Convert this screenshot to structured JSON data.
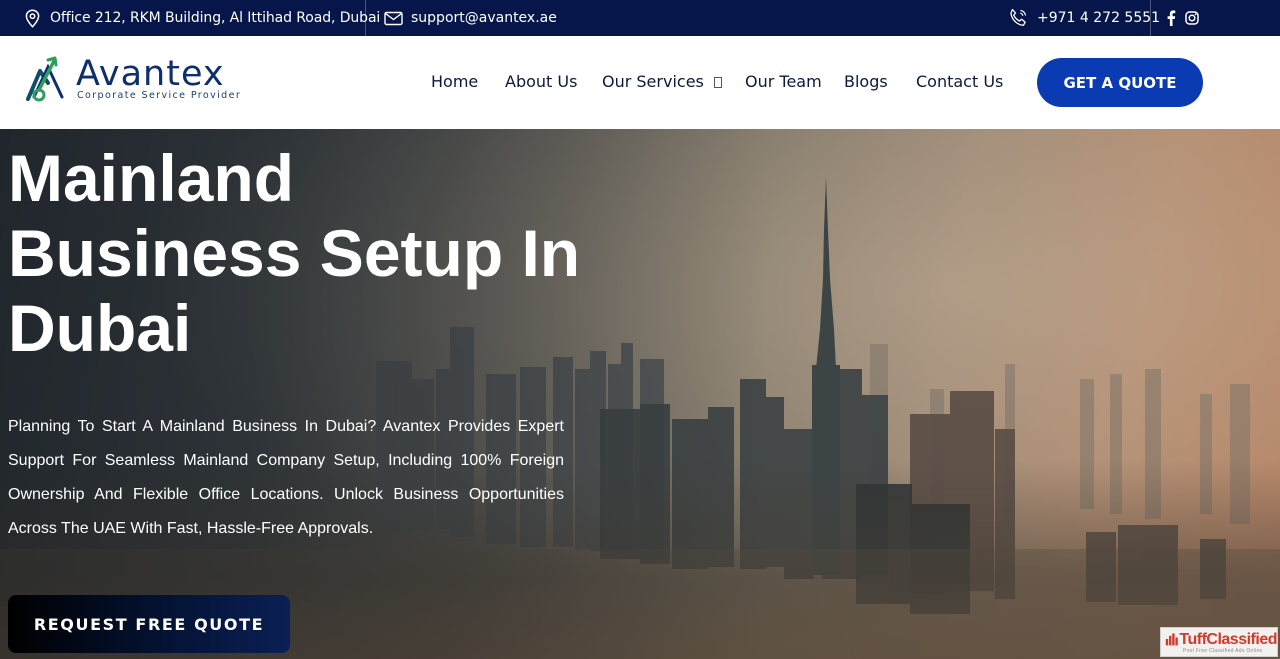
{
  "topbar": {
    "address": "Office 212, RKM Building, Al Ittihad Road, Dubai",
    "email": "support@avantex.ae",
    "phone": "+971 4 272 5551",
    "address_icon": "map-pin-icon",
    "email_icon": "envelope-icon",
    "phone_icon": "phone-icon",
    "social": [
      "facebook-icon",
      "instagram-icon"
    ]
  },
  "logo": {
    "name": "Avantex",
    "tagline": "Corporate Service Provider"
  },
  "nav": {
    "items": [
      "Home",
      "About Us",
      "Our Services",
      "Our Team",
      "Blogs",
      "Contact Us"
    ],
    "cta": "GET A QUOTE"
  },
  "hero": {
    "title_lines": [
      "Mainland",
      "Business Setup In",
      "Dubai"
    ],
    "description": "Planning To Start A Mainland Business In Dubai? Avantex Provides Expert Support For Seamless Mainland Company Setup, Including 100% Foreign Ownership And Flexible Office Locations. Unlock Business Opportunities Across The UAE With Fast, Hassle-Free Approvals.",
    "cta": "REQUEST FREE QUOTE"
  },
  "watermark": {
    "brand": "TuffClassified",
    "tagline": "Post Free Classified Ads Online"
  },
  "colors": {
    "topbar_bg": "#06164a",
    "brand_blue": "#0b3bb3",
    "logo_navy": "#0d2f6b",
    "logo_green": "#2e9e5b"
  }
}
